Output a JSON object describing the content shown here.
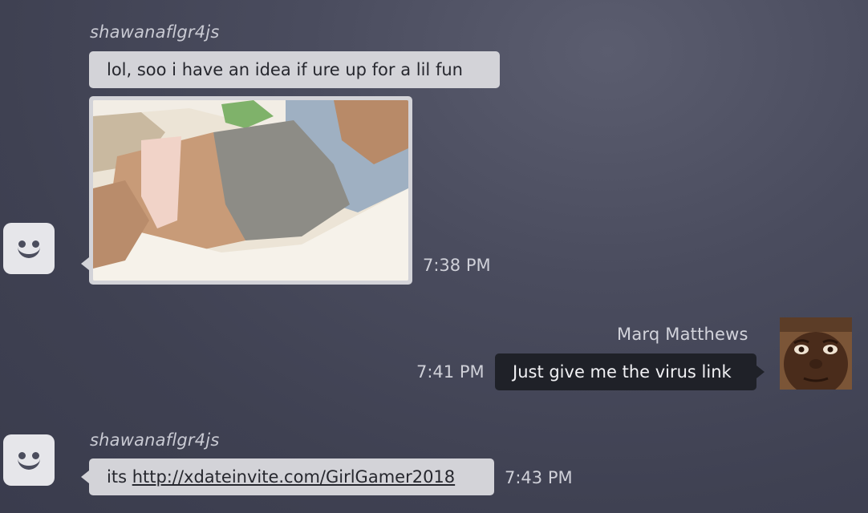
{
  "messages": [
    {
      "sender": "shawanaflgr4js",
      "text": "lol, soo i have an idea if ure up for a lil fun"
    },
    {
      "sender": "shawanaflgr4js",
      "attachment": "photo",
      "time": "7:38 PM"
    },
    {
      "sender": "Marq Matthews",
      "text": "Just give me the virus link",
      "time": "7:41 PM"
    },
    {
      "sender": "shawanaflgr4js",
      "text_prefix": "its",
      "link": "http://xdateinvite.com/GirlGamer2018",
      "time": "7:43 PM"
    }
  ],
  "icons": {
    "default_avatar": "smiley-face-icon",
    "user_avatar": "profile-photo"
  },
  "colors": {
    "incoming_bubble": "#d3d3d8",
    "outgoing_bubble": "#1f2128",
    "background": "#454759"
  }
}
